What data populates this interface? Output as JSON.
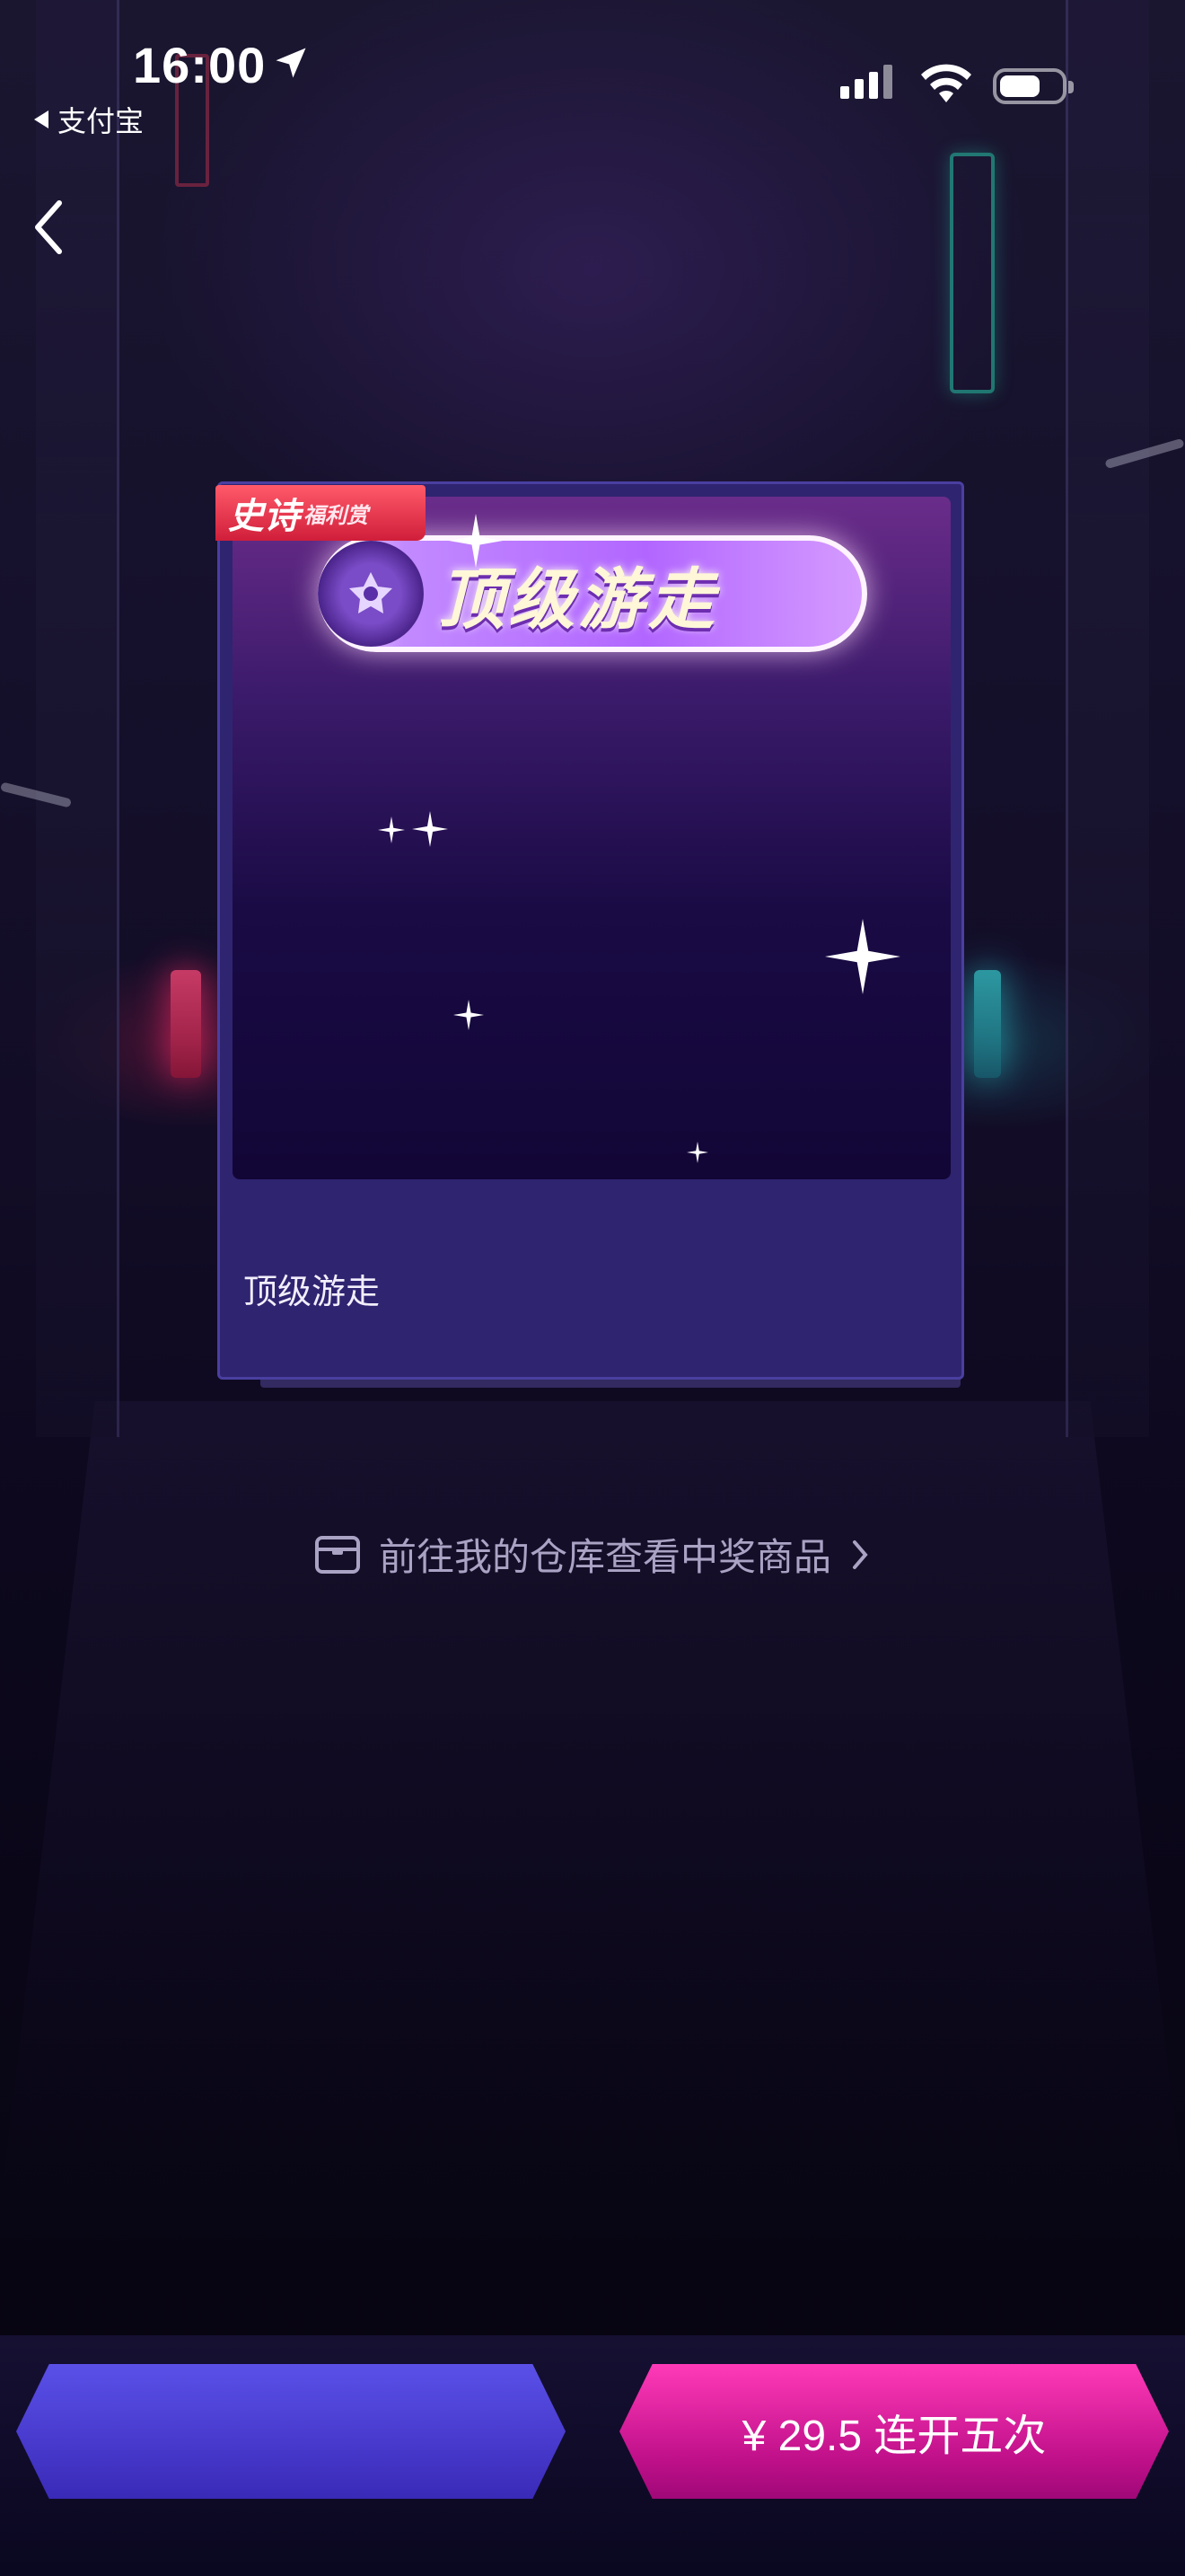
{
  "status_bar": {
    "time": "16:00",
    "back_app": "支付宝"
  },
  "card": {
    "badge_main": "史诗",
    "badge_sub": "福利赏",
    "title_plate": "顶级游走",
    "label": "顶级游走"
  },
  "warehouse_link": {
    "text": "前往我的仓库查看中奖商品"
  },
  "buttons": {
    "left_label": "",
    "right_label": "¥ 29.5  连开五次"
  },
  "colors": {
    "accent_pink": "#e0129a",
    "accent_purple": "#4a3fd0",
    "card_bg": "#2f2470"
  }
}
